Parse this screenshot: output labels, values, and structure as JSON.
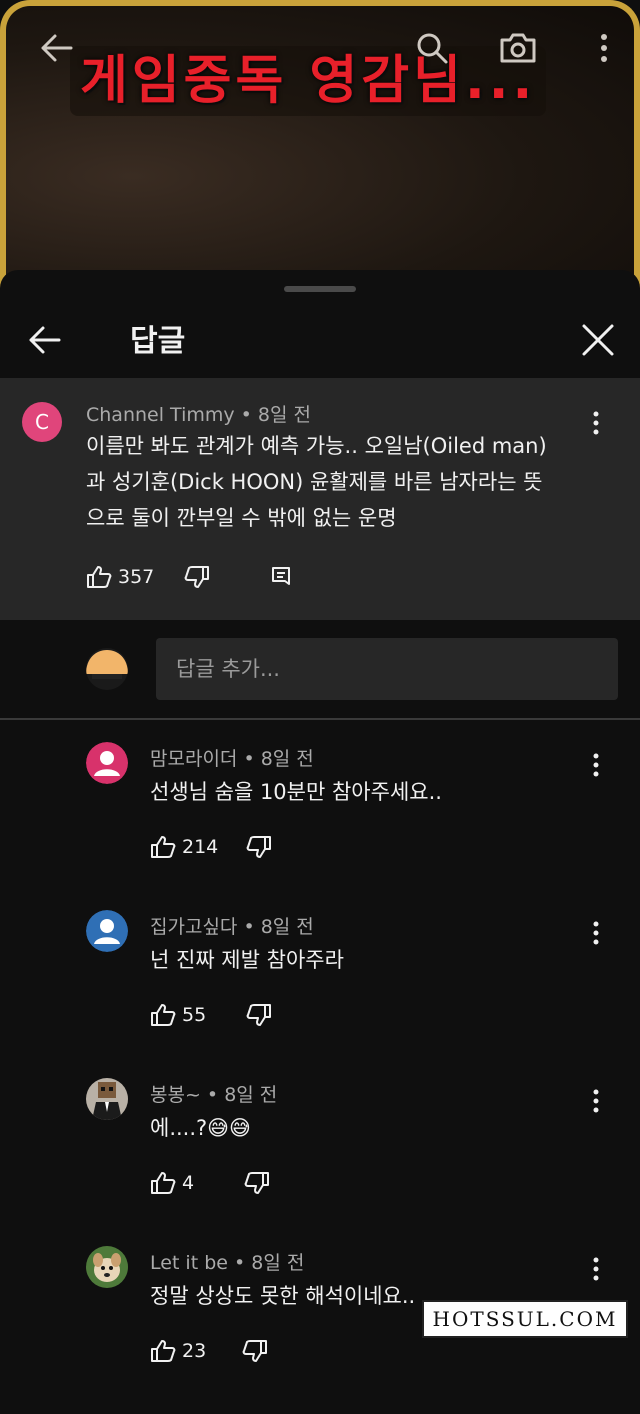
{
  "video": {
    "title_overlay": "게임중독 영감님..."
  },
  "sheet": {
    "title": "답글"
  },
  "parent_comment": {
    "avatar_letter": "C",
    "avatar_color": "#e0457b",
    "author": "Channel Timmy",
    "time": "8일 전",
    "text_lines": [
      "이름만 봐도 관계가 예측 가능.. 오일남(Oiled man)",
      "과 성기훈(Dick HOON) 윤활제를 바른 남자라는 뜻",
      "으로 둘이 깐부일 수 밖에 없는 운명"
    ],
    "likes": "357"
  },
  "add_reply": {
    "placeholder": "답글 추가..."
  },
  "replies": [
    {
      "author": "맘모라이더",
      "time": "8일 전",
      "text": "선생님 숨을 10분만 참아주세요..",
      "likes": "214",
      "avatar": "pink-person"
    },
    {
      "author": "집가고싶다",
      "time": "8일 전",
      "text": "넌 진짜 제발 참아주라",
      "likes": "55",
      "avatar": "blue-person"
    },
    {
      "author": "봉봉~",
      "time": "8일 전",
      "text": "에....?😅😅",
      "likes": "4",
      "avatar": "photo-suit"
    },
    {
      "author": "Let it be",
      "time": "8일 전",
      "text": "정말 상상도 못한 해석이네요..",
      "likes": "23",
      "avatar": "photo-dog"
    }
  ],
  "watermark": "HOTSSUL.COM",
  "colors": {
    "background": "#0f0f0f",
    "card": "#272727",
    "title_red": "#e8202a"
  }
}
